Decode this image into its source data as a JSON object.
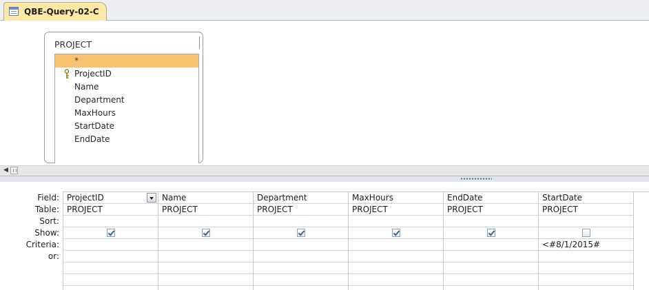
{
  "window": {
    "tab_title": "QBE-Query-02-C"
  },
  "design": {
    "table_name": "PROJECT",
    "fields": [
      "*",
      "ProjectID",
      "Name",
      "Department",
      "MaxHours",
      "StartDate",
      "EndDate"
    ],
    "selected_field": "*",
    "key_field": "ProjectID"
  },
  "grid": {
    "row_labels": {
      "field": "Field:",
      "table": "Table:",
      "sort": "Sort:",
      "show": "Show:",
      "criteria": "Criteria:",
      "or": "or:"
    },
    "columns": [
      {
        "field": "ProjectID",
        "table": "PROJECT",
        "sort": "",
        "show": true,
        "criteria": "",
        "or": ""
      },
      {
        "field": "Name",
        "table": "PROJECT",
        "sort": "",
        "show": true,
        "criteria": "",
        "or": ""
      },
      {
        "field": "Department",
        "table": "PROJECT",
        "sort": "",
        "show": true,
        "criteria": "",
        "or": ""
      },
      {
        "field": "MaxHours",
        "table": "PROJECT",
        "sort": "",
        "show": true,
        "criteria": "",
        "or": ""
      },
      {
        "field": "EndDate",
        "table": "PROJECT",
        "sort": "",
        "show": true,
        "criteria": "",
        "or": ""
      },
      {
        "field": "StartDate",
        "table": "PROJECT",
        "sort": "",
        "show": false,
        "criteria": "<#8/1/2015#",
        "or": ""
      }
    ],
    "active_column": 0
  },
  "icons": {
    "tab": "query-icon",
    "key": "primary-key-icon",
    "scroll_left": "scroll-left-arrow-icon",
    "dropdown": "chevron-down-icon"
  },
  "colors": {
    "tab_background": "#fde9a6",
    "selected_field": "#f8c271",
    "grid_line": "#c8c8c8"
  }
}
